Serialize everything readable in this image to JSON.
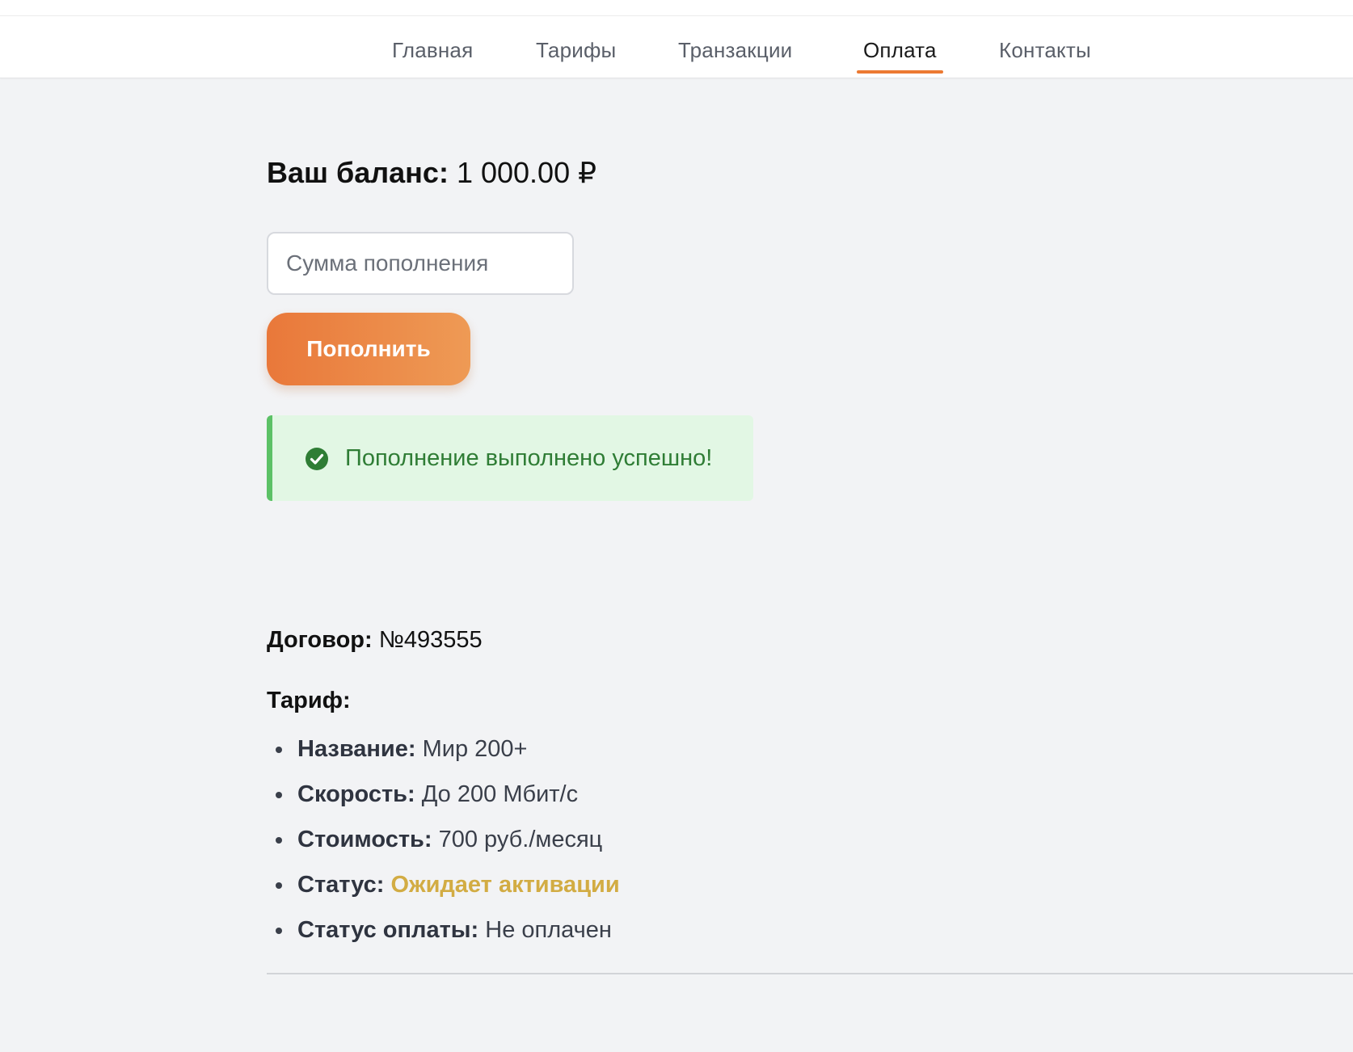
{
  "nav": {
    "items": [
      {
        "label": "Главная"
      },
      {
        "label": "Тарифы"
      },
      {
        "label": "Транзакции"
      },
      {
        "label": "Оплата"
      },
      {
        "label": "Контакты"
      }
    ],
    "active_index": 3,
    "accent_color": "#ec7a33"
  },
  "balance": {
    "label": "Ваш баланс:",
    "value": "1 000.00 ₽"
  },
  "topup": {
    "placeholder": "Сумма пополнения",
    "value": "",
    "button_label": "Пополнить"
  },
  "alert": {
    "icon": "check-circle-icon",
    "text": "Пополнение выполнено успешно!",
    "color": "#2f7d35"
  },
  "contract": {
    "label": "Договор:",
    "value": "№493555"
  },
  "tariff": {
    "heading": "Тариф:",
    "items": [
      {
        "label": "Название:",
        "value": "Мир 200+"
      },
      {
        "label": "Скорость:",
        "value": "До 200 Мбит/с"
      },
      {
        "label": "Стоимость:",
        "value": "700 руб./месяц"
      },
      {
        "label": "Статус:",
        "value": "Ожидает активации",
        "value_color": "#d2ac43"
      },
      {
        "label": "Статус оплаты:",
        "value": "Не оплачен"
      }
    ]
  }
}
